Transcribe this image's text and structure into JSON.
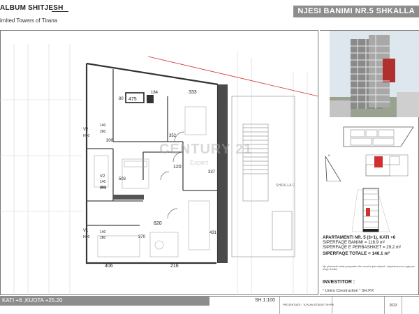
{
  "header": {
    "album_title": "ALBUM SHITJESH",
    "subtitle": "imited   Towers of Tirana",
    "unit_title": "NJESI BANIMI NR.5 SHKALLA"
  },
  "plan": {
    "dims": [
      "475",
      "80",
      "184",
      "333",
      "352",
      "300",
      "140",
      "260",
      "120",
      "503",
      "140",
      "280",
      "337",
      "820",
      "370",
      "431",
      "140",
      "280",
      "406",
      "216",
      "V2",
      "H=0",
      "V2",
      "H=0",
      "V1",
      "H=0"
    ],
    "stair_label": "SHKALLA C"
  },
  "watermark": {
    "main": "CENTURY 21",
    "sub": "Expert"
  },
  "specs": {
    "apartment": "APARTAMENTI NR. 5 (3+1), KATI +6",
    "siperfaqe_banimi": "SIPERFAQE BANIMI = 116.9 m²",
    "siperfaqe_perbashket": "SIPERFAQE E PERBASHKET = 29.2 m²",
    "siperfaqe_totale": "SIPERFAQE TOTALE = 146.1 m²",
    "note": "Kjo planimetri eshte paraprake dhe mund te jete subjekt i ndryshimeve te vogla per arsye teknike",
    "investitor_label": "INVESTITOR :",
    "investitor_name": "\" Unico Construction \" SH.P.K"
  },
  "footer": {
    "floor_label": "KATI +6 ,KUOTA +25.20",
    "scale": "SH.1:100",
    "projektues": "PROJEKTUES : \"A-PLAN STUDIO\" SH.P.K",
    "year": "2023"
  },
  "colors": {
    "header_bar": "#8d8d8d",
    "accent_red": "#d03030",
    "wall": "#333333"
  }
}
